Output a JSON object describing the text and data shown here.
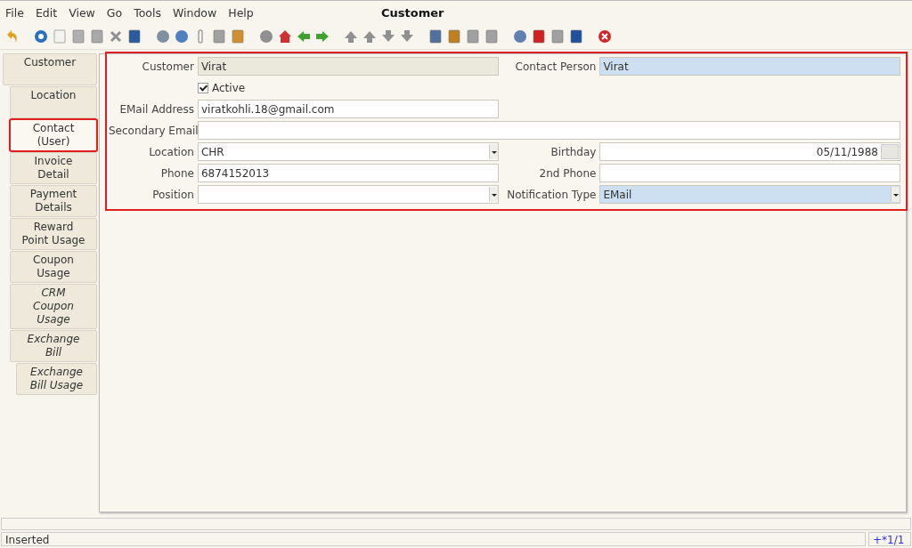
{
  "menu": [
    "File",
    "Edit",
    "View",
    "Go",
    "Tools",
    "Window",
    "Help"
  ],
  "window": {
    "title": "Customer"
  },
  "tabs": [
    {
      "label": "Customer",
      "selected": false,
      "italic": false,
      "highlighted": false,
      "children": [
        {
          "label": "Location",
          "selected": false,
          "italic": false,
          "highlighted": false
        },
        {
          "label": "Contact (User)",
          "selected": true,
          "italic": false,
          "highlighted": true
        },
        {
          "label": "Invoice Detail",
          "selected": false,
          "italic": false,
          "highlighted": false
        },
        {
          "label": "Payment Details",
          "selected": false,
          "italic": false,
          "highlighted": false
        },
        {
          "label": "Reward Point Usage",
          "selected": false,
          "italic": false,
          "highlighted": false
        },
        {
          "label": "Coupon Usage",
          "selected": false,
          "italic": false,
          "highlighted": false
        },
        {
          "label": "CRM Coupon Usage",
          "selected": false,
          "italic": true,
          "highlighted": false
        },
        {
          "label": "Exchange Bill",
          "selected": false,
          "italic": true,
          "highlighted": false,
          "children": [
            {
              "label": "Exchange Bill Usage",
              "selected": false,
              "italic": true,
              "highlighted": false
            }
          ]
        }
      ]
    }
  ],
  "form": {
    "highlighted": true,
    "rows": [
      [
        {
          "kind": "text",
          "label": "Customer",
          "value": "Virat",
          "readonly": true
        },
        {
          "kind": "text",
          "label": "Contact Person",
          "value": "Virat",
          "mandatory": true
        }
      ],
      [
        {
          "kind": "check",
          "label": "Active",
          "checked": true
        }
      ],
      [
        {
          "kind": "text",
          "label": "EMail Address",
          "value": "viratkohli.18@gmail.com"
        }
      ],
      [
        {
          "kind": "wide",
          "label": "Secondary Email"
        }
      ],
      [
        {
          "kind": "combo",
          "label": "Location",
          "value": "CHR"
        },
        {
          "kind": "date",
          "label": "Birthday",
          "value": "05/11/1988"
        }
      ],
      [
        {
          "kind": "text",
          "label": "Phone",
          "value": "6874152013"
        },
        {
          "kind": "text",
          "label": "2nd Phone"
        }
      ],
      [
        {
          "kind": "combo",
          "label": "Position"
        },
        {
          "kind": "combo",
          "label": "Notification Type",
          "value": "EMail",
          "mandatory": true
        }
      ]
    ]
  },
  "status_bar": {
    "message": "Inserted",
    "record": "+*1/1"
  }
}
